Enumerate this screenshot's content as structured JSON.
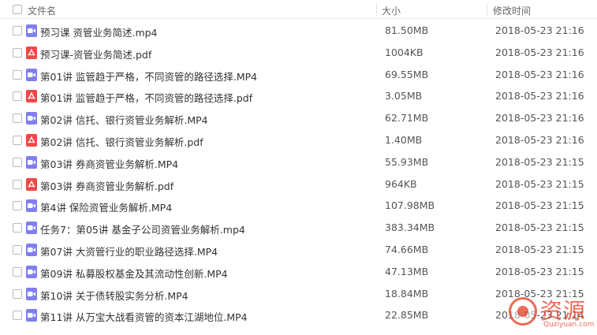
{
  "header": {
    "name_label": "文件名",
    "size_label": "大小",
    "date_label": "修改时间"
  },
  "files": [
    {
      "type": "video",
      "name": "预习课 资管业务简述.mp4",
      "size": "81.50MB",
      "date": "2018-05-23 21:16"
    },
    {
      "type": "pdf",
      "name": "预习课-资管业务简述.pdf",
      "size": "1004KB",
      "date": "2018-05-23 21:16"
    },
    {
      "type": "video",
      "name": "第01讲 监管趋于严格，不同资管的路径选择.MP4",
      "size": "69.55MB",
      "date": "2018-05-23 21:16"
    },
    {
      "type": "pdf",
      "name": "第01讲 监管趋于严格，不同资管的路径选择.pdf",
      "size": "3.05MB",
      "date": "2018-05-23 21:16"
    },
    {
      "type": "video",
      "name": "第02讲 信托、银行资管业务解析.MP4",
      "size": "62.71MB",
      "date": "2018-05-23 21:16"
    },
    {
      "type": "pdf",
      "name": "第02讲 信托、银行资管业务解析.pdf",
      "size": "1.40MB",
      "date": "2018-05-23 21:16"
    },
    {
      "type": "video",
      "name": "第03讲 券商资管业务解析.MP4",
      "size": "55.93MB",
      "date": "2018-05-23 21:15"
    },
    {
      "type": "pdf",
      "name": "第03讲 券商资管业务解析.pdf",
      "size": "964KB",
      "date": "2018-05-23 21:15"
    },
    {
      "type": "video",
      "name": "第4讲 保险资管业务解析.MP4",
      "size": "107.98MB",
      "date": "2018-05-23 21:15"
    },
    {
      "type": "video",
      "name": "任务7：第05讲 基金子公司资管业务解析.mp4",
      "size": "383.34MB",
      "date": "2018-05-23 21:15"
    },
    {
      "type": "video",
      "name": "第07讲 大资管行业的职业路径选择.MP4",
      "size": "74.66MB",
      "date": "2018-05-23 21:15"
    },
    {
      "type": "video",
      "name": "第09讲 私募股权基金及其流动性创新.MP4",
      "size": "47.13MB",
      "date": "2018-05-23 21:15"
    },
    {
      "type": "video",
      "name": "第10讲 关于债转股实务分析.MP4",
      "size": "18.84MB",
      "date": "2018-05-23 21:15"
    },
    {
      "type": "video",
      "name": "第11讲 从万宝大战看资管的资本江湖地位.MP4",
      "size": "22.85MB",
      "date": "2018-05-23 21:14"
    }
  ],
  "watermark": {
    "text": "资源",
    "subtext": "Quziyuan.com"
  },
  "colors": {
    "video_icon": "#7f7ff0",
    "pdf_icon": "#f04848",
    "watermark": "#e8533a"
  }
}
